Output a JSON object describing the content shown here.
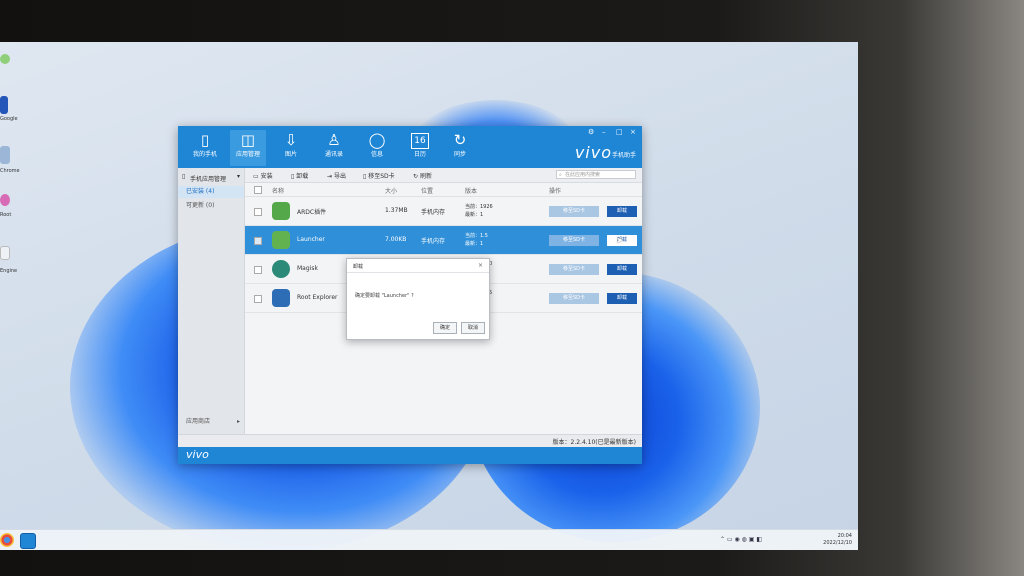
{
  "window": {
    "brand": "vivo",
    "brand_sub": "手机助手",
    "footer_brand": "vivo",
    "toolbar": [
      {
        "label": "我的手机",
        "icon": "phone-icon"
      },
      {
        "label": "应用管理",
        "icon": "apps-icon",
        "active": true
      },
      {
        "label": "图片",
        "icon": "download-arrow-icon"
      },
      {
        "label": "通讯录",
        "icon": "contacts-icon"
      },
      {
        "label": "信息",
        "icon": "message-icon"
      },
      {
        "label": "日历",
        "icon": "calendar-icon",
        "glyph": "16"
      },
      {
        "label": "同步",
        "icon": "sync-icon"
      }
    ],
    "controls": [
      "⚙",
      "–",
      "□",
      "×"
    ]
  },
  "sidebar": {
    "header": "手机应用管理",
    "items": [
      {
        "label": "已安装 (4)",
        "selected": true
      },
      {
        "label": "可更新 (0)",
        "selected": false
      }
    ],
    "bottom": "应用商店"
  },
  "actions": {
    "install": "安装",
    "uninstall": "卸载",
    "export": "导出",
    "move_sd": "移至SD卡",
    "refresh": "刷新",
    "search_placeholder": "在此应用内搜索"
  },
  "table": {
    "headers": [
      "名称",
      "大小",
      "位置",
      "版本",
      "操作"
    ],
    "rows": [
      {
        "name": "ARDC插件",
        "size": "1.37MB",
        "location": "手机内存",
        "version": "当前：1926",
        "version2": "最新：1",
        "icon_color": "#55a84a",
        "selected": false,
        "move": "移至SD卡",
        "uninstall": "卸载"
      },
      {
        "name": "Launcher",
        "size": "7.00KB",
        "location": "手机内存",
        "version": "当前：1.5",
        "version2": "最新：1",
        "icon_color": "#62b34f",
        "selected": true,
        "move": "移至SD卡",
        "uninstall": "卸载"
      },
      {
        "name": "Magisk",
        "size": "",
        "location": "",
        "version": "0",
        "version2": "",
        "icon_color": "#2b8a78",
        "selected": false,
        "move": "移至SD卡",
        "uninstall": "卸载"
      },
      {
        "name": "Root Explorer",
        "size": "",
        "location": "",
        "version": "5",
        "version2": "",
        "icon_color": "#2c6db5",
        "selected": false,
        "move": "移至SD卡",
        "uninstall": "卸载"
      }
    ]
  },
  "status": {
    "version": "版本：2.2.4.10(已是最新版本)"
  },
  "dialog": {
    "title": "卸载",
    "message": "确定要卸载 \"Launcher\" ?",
    "ok": "确定",
    "cancel": "取消"
  },
  "desktop": {
    "icon_labels": [
      "Google",
      "Chrome",
      "Android",
      "Root",
      "Engine"
    ]
  },
  "taskbar": {
    "time": "20:04",
    "date": "2022/12/10"
  }
}
